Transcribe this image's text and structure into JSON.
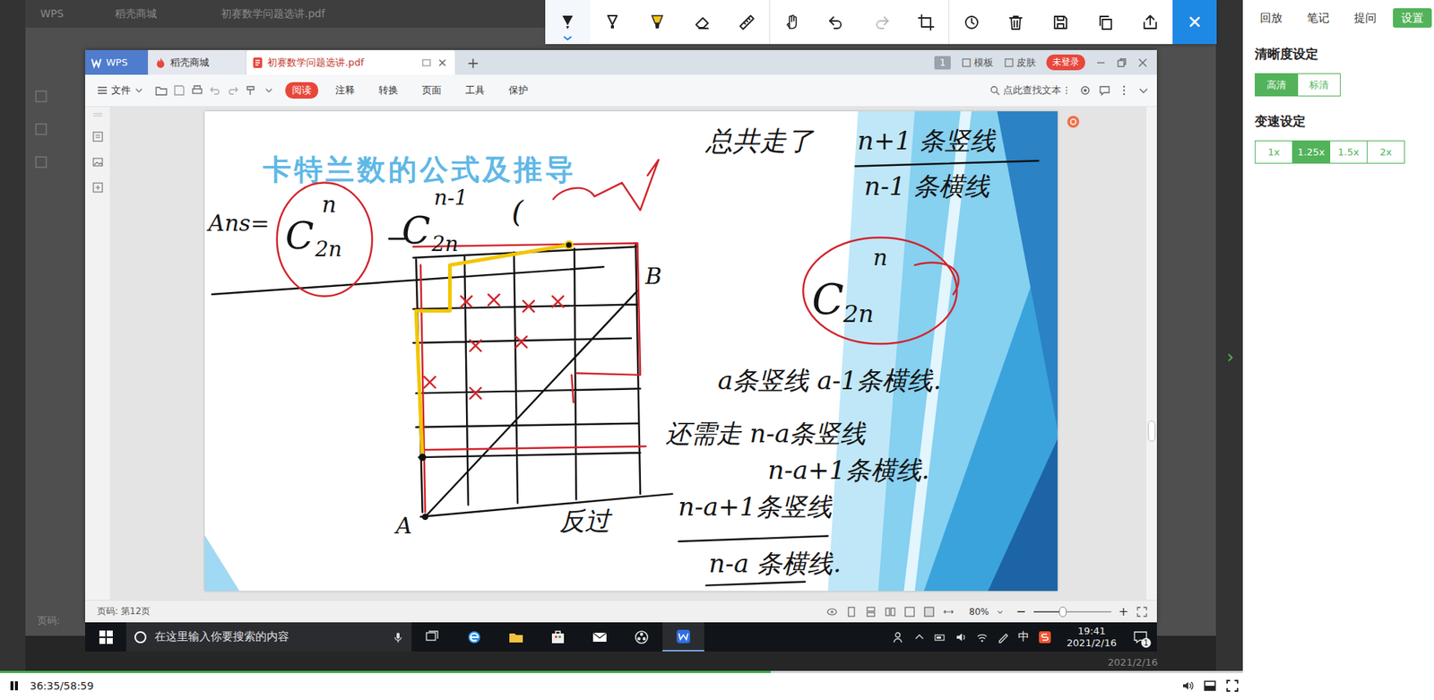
{
  "annotation_toolbar": {
    "tools": [
      {
        "kind": "pen",
        "selected": true,
        "disabled": false
      },
      {
        "kind": "marker",
        "selected": false,
        "disabled": false
      },
      {
        "kind": "highlighter",
        "selected": false,
        "disabled": false
      },
      {
        "kind": "eraser",
        "selected": false,
        "disabled": false
      },
      {
        "kind": "ruler",
        "selected": false,
        "disabled": false
      },
      {
        "kind": "hand",
        "selected": false,
        "disabled": false
      },
      {
        "kind": "undo",
        "selected": false,
        "disabled": false
      },
      {
        "kind": "redo",
        "selected": false,
        "disabled": true
      },
      {
        "kind": "crop",
        "selected": false,
        "disabled": false
      },
      {
        "kind": "history",
        "selected": false,
        "disabled": false
      },
      {
        "kind": "trash",
        "selected": false,
        "disabled": false
      },
      {
        "kind": "save",
        "selected": false,
        "disabled": false
      },
      {
        "kind": "copy",
        "selected": false,
        "disabled": false
      },
      {
        "kind": "share",
        "selected": false,
        "disabled": false
      }
    ],
    "close": "✕"
  },
  "screen_recording": {
    "outer": {
      "tabs": [
        "WPS",
        "稻壳商城",
        "初赛数学问题选讲.pdf"
      ],
      "page_label": "页码:",
      "date": "2021/2/16"
    },
    "wps_window": {
      "tabs": [
        {
          "label": "WPS",
          "selected": false
        },
        {
          "label": "稻壳商城",
          "selected": false
        },
        {
          "label": "初赛数学问题选讲.pdf",
          "selected": true
        }
      ],
      "tab_close": "×",
      "new_tab": "+",
      "page_badge": "1",
      "header_actions": [
        "模板",
        "皮肤"
      ],
      "login": "未登录",
      "file_menu": "文件",
      "menu": [
        {
          "label": "阅读",
          "selected": true
        },
        {
          "label": "注释",
          "selected": false
        },
        {
          "label": "转换",
          "selected": false
        },
        {
          "label": "页面",
          "selected": false
        },
        {
          "label": "工具",
          "selected": false
        },
        {
          "label": "保护",
          "selected": false
        }
      ],
      "search_placeholder": "点此查找文本",
      "slide": {
        "title": "卡特兰数的公式及推导",
        "ink": [
          "Ans=",
          "C",
          "n",
          "2n",
          "−",
          "C",
          "n-1",
          "2n",
          "(",
          "总共走了",
          "n+1 条竖线",
          "n-1 条横线",
          "C",
          "n",
          "2n",
          "a条竖线 a-1条横线.",
          "还需走 n-a条竖线",
          "n-a+1条横线.",
          "B",
          "A",
          "反过",
          "n-a+1条竖线",
          "n-a 条横线."
        ]
      },
      "status": {
        "page": "页码: 第12页",
        "zoom": "80%",
        "zoom_out": "−",
        "zoom_in": "+",
        "zoom_level": 0.38
      }
    },
    "taskbar": {
      "search_placeholder": "在这里输入你要搜索的内容",
      "ime": "中",
      "time": "19:41",
      "date": "2021/2/16",
      "notifications": "1"
    }
  },
  "player": {
    "playing": true,
    "time": "36:35/58:59",
    "progress": 0.62
  },
  "side_panel": {
    "tabs": [
      {
        "label": "回放",
        "selected": false
      },
      {
        "label": "笔记",
        "selected": false
      },
      {
        "label": "提问",
        "selected": false
      },
      {
        "label": "设置",
        "selected": true
      }
    ],
    "quality": {
      "title": "清晰度设定",
      "options": [
        {
          "label": "高清",
          "selected": true
        },
        {
          "label": "标清",
          "selected": false
        }
      ]
    },
    "speed": {
      "title": "变速设定",
      "options": [
        {
          "label": "1x",
          "selected": false
        },
        {
          "label": "1.25x",
          "selected": true
        },
        {
          "label": "1.5x",
          "selected": false
        },
        {
          "label": "2x",
          "selected": false
        }
      ]
    },
    "collapse": "›"
  }
}
